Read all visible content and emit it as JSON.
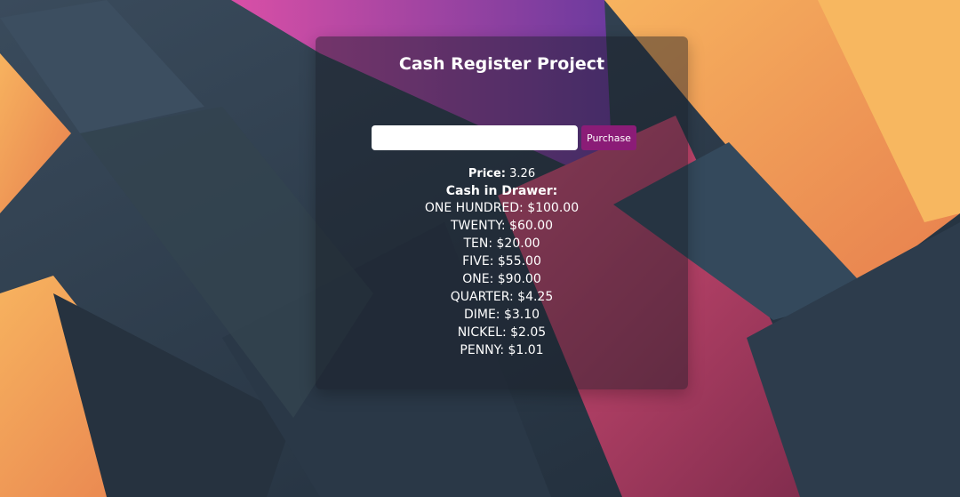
{
  "app": {
    "title": "Cash Register Project"
  },
  "form": {
    "cash_input_value": "",
    "cash_input_placeholder": "",
    "purchase_label": "Purchase"
  },
  "price": {
    "label": "Price:",
    "value": "3.26"
  },
  "drawer": {
    "title": "Cash in Drawer:",
    "items": [
      {
        "text": "ONE HUNDRED: $100.00"
      },
      {
        "text": "TWENTY: $60.00"
      },
      {
        "text": "TEN: $20.00"
      },
      {
        "text": "FIVE: $55.00"
      },
      {
        "text": "ONE: $90.00"
      },
      {
        "text": "QUARTER: $4.25"
      },
      {
        "text": "DIME: $3.10"
      },
      {
        "text": "NICKEL: $2.05"
      },
      {
        "text": "PENNY: $1.01"
      }
    ]
  },
  "colors": {
    "button": "#8b1c77",
    "panel": "rgba(22, 26, 36, 0.45)",
    "background_dark": "#2b3a4a",
    "background_orange": "#f4a45a",
    "background_magenta": "#c8466e",
    "background_purple": "#8a3fae"
  }
}
